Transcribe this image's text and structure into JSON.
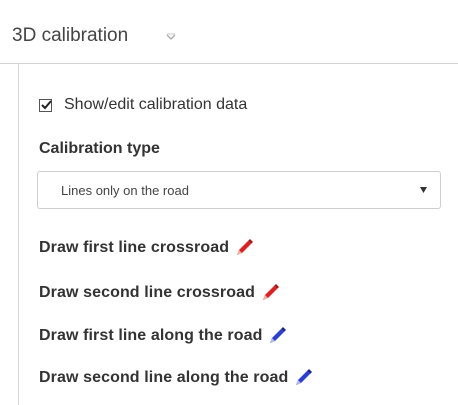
{
  "panel": {
    "title": "3D calibration"
  },
  "calibration_toggle": {
    "label": "Show/edit calibration data",
    "checked": true
  },
  "calibration_type": {
    "label": "Calibration type",
    "selected": "Lines only on the road"
  },
  "draw_actions": [
    {
      "label": "Draw first line crossroad",
      "icon": "pencil-icon",
      "color": "#e02020"
    },
    {
      "label": "Draw second line crossroad",
      "icon": "pencil-icon",
      "color": "#e02020"
    },
    {
      "label": "Draw first line along the road",
      "icon": "pencil-icon",
      "color": "#2a3fd6"
    },
    {
      "label": "Draw second line along the road",
      "icon": "pencil-icon",
      "color": "#2a3fd6"
    }
  ]
}
